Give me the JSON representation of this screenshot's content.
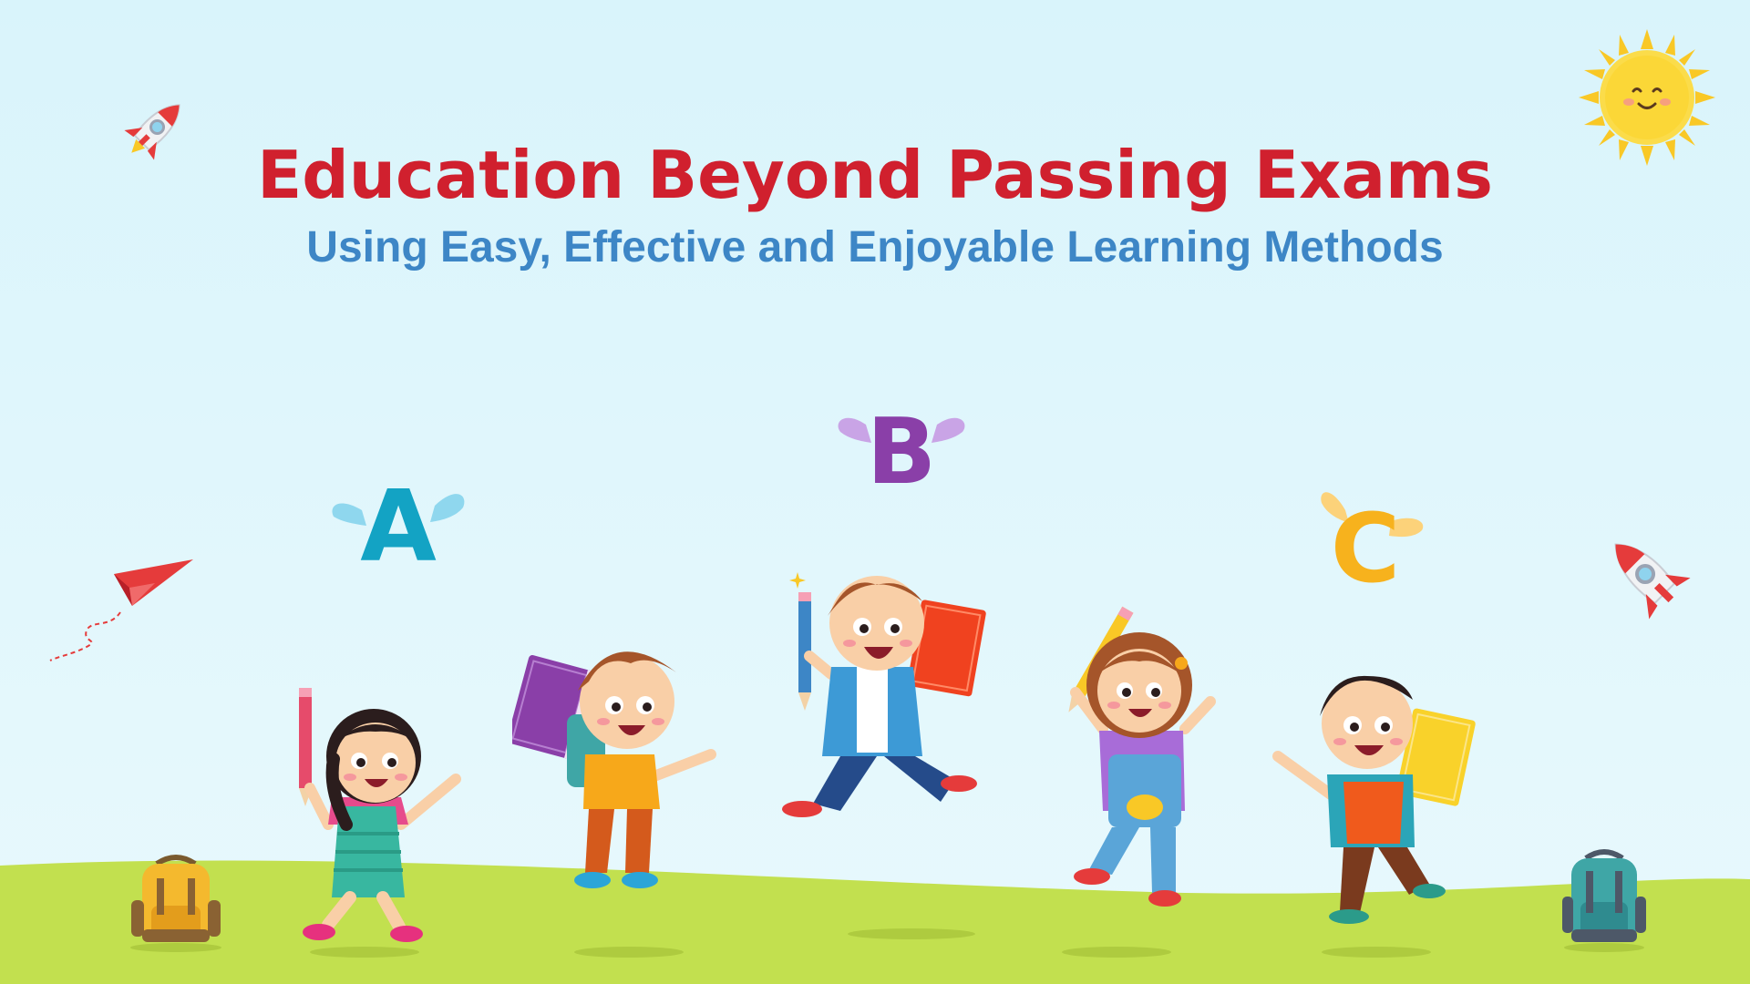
{
  "header": {
    "title": "Education Beyond Passing Exams",
    "subtitle": "Using Easy, Effective and Enjoyable Learning Methods"
  },
  "flying_letters": [
    {
      "letter": "A",
      "color": "#13a3c4",
      "wing_color": "#8fd7ee"
    },
    {
      "letter": "B",
      "color": "#8a3fa8",
      "wing_color": "#c9a4e6"
    },
    {
      "letter": "C",
      "color": "#f7b21d",
      "wing_color": "#fcd27a"
    }
  ],
  "colors": {
    "title": "#d0202e",
    "subtitle": "#3d86c6",
    "sky": "#d9f4fb",
    "grass": "#c2e04f",
    "sun": "#f9c826"
  },
  "icons": [
    "rocket-icon",
    "sun-icon",
    "paper-plane-icon",
    "backpack-icon",
    "pencil-icon",
    "book-icon"
  ]
}
